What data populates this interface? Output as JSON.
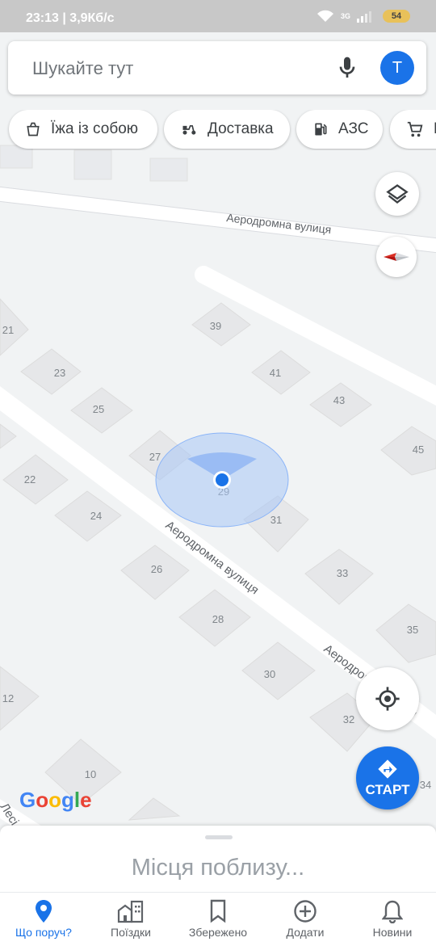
{
  "status": {
    "time": "23:13",
    "speed": "3,9Кб/с",
    "battery": "54",
    "network": "3G"
  },
  "search": {
    "placeholder": "Шукайте тут",
    "avatar_letter": "T"
  },
  "chips": [
    {
      "label": "Їжа із собою",
      "icon": "takeout-icon"
    },
    {
      "label": "Доставка",
      "icon": "scooter-icon"
    },
    {
      "label": "АЗС",
      "icon": "gas-station-icon"
    },
    {
      "label": "П",
      "icon": "cart-icon"
    }
  ],
  "map": {
    "streets": [
      "Аеродромна вулиця",
      "Аеродромна вулиця",
      "Аеродромна вулиця",
      "Лесі"
    ],
    "house_numbers": [
      "21",
      "39",
      "23",
      "41",
      "25",
      "43",
      "27",
      "45",
      "22",
      "29",
      "24",
      "31",
      "26",
      "33",
      "28",
      "35",
      "30",
      "12",
      "32",
      "10",
      "34"
    ],
    "attribution": "Google",
    "logo_colors": [
      "#4285f4",
      "#ea4335",
      "#fbbc05",
      "#4285f4",
      "#34a853",
      "#ea4335"
    ]
  },
  "start_label": "СТАРТ",
  "sheet_title": "Місця поблизу...",
  "nav": [
    {
      "label": "Що поруч?",
      "icon": "location-pin-icon",
      "active": true
    },
    {
      "label": "Поїздки",
      "icon": "buildings-icon",
      "active": false
    },
    {
      "label": "Збережено",
      "icon": "bookmark-icon",
      "active": false
    },
    {
      "label": "Додати",
      "icon": "add-circle-icon",
      "active": false
    },
    {
      "label": "Новини",
      "icon": "bell-icon",
      "active": false
    }
  ],
  "colors": {
    "accent": "#1a73e8",
    "compass": "#d93025"
  }
}
